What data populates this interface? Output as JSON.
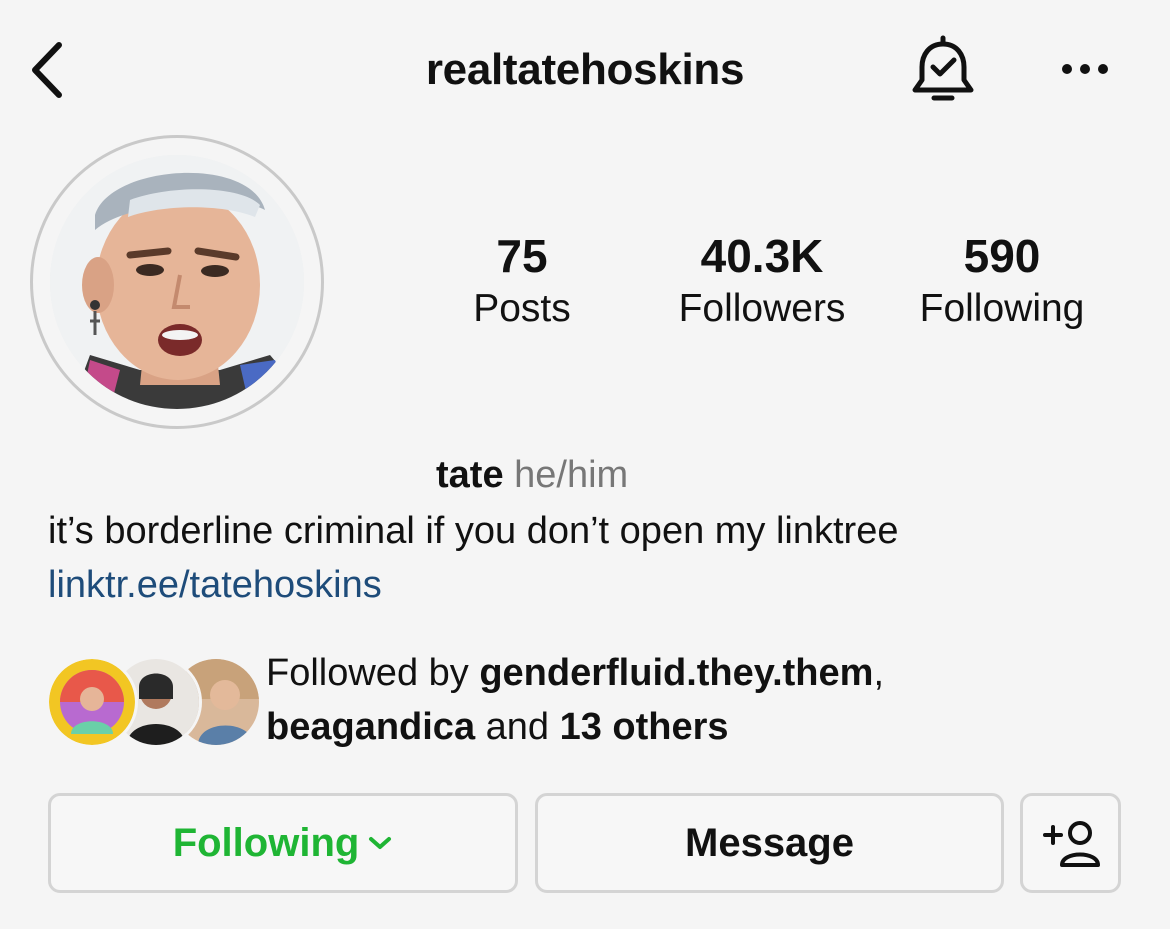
{
  "header": {
    "username": "realtatehoskins",
    "back_icon": "chevron-left-icon",
    "bell_icon": "bell-check-icon",
    "more_icon": "ellipsis-icon"
  },
  "stats": {
    "posts": {
      "value": "75",
      "label": "Posts"
    },
    "followers": {
      "value": "40.3K",
      "label": "Followers"
    },
    "following": {
      "value": "590",
      "label": "Following"
    }
  },
  "bio": {
    "name": "tate",
    "pronouns": "he/him",
    "text": "it’s borderline criminal if you don’t open my linktree",
    "link": "linktr.ee/tatehoskins",
    "link_color": "#1e4c7a"
  },
  "followed_by": {
    "prefix": "Followed by",
    "user1": "genderfluid.they.them",
    "separator": ",",
    "user2": "beagandica",
    "conjunction": "and",
    "others": "13 others"
  },
  "buttons": {
    "following_label": "Following",
    "following_color": "#1fb534",
    "message_label": "Message",
    "add_icon": "add-person-icon"
  }
}
